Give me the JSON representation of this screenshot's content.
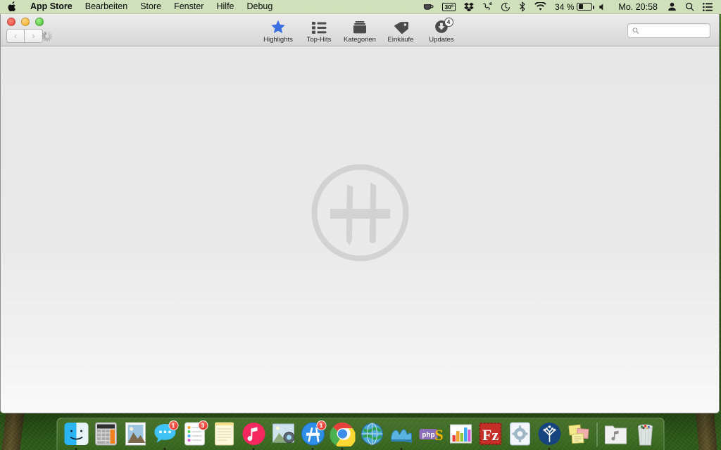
{
  "menubar": {
    "apple_icon": "apple-icon",
    "items": [
      {
        "label": "App Store",
        "bold": true
      },
      {
        "label": "Bearbeiten",
        "bold": false
      },
      {
        "label": "Store",
        "bold": false
      },
      {
        "label": "Fenster",
        "bold": false
      },
      {
        "label": "Hilfe",
        "bold": false
      },
      {
        "label": "Debug",
        "bold": false
      }
    ],
    "status": {
      "caffeine_icon": "coffee-cup-icon",
      "weather_temp": "30º",
      "dropbox_icon": "dropbox-icon",
      "phone_icon": "phone-handset-icon",
      "timemachine_icon": "time-machine-icon",
      "bluetooth_icon": "bluetooth-icon",
      "wifi_icon": "wifi-icon",
      "battery_percent": "34 %",
      "battery_level": 34,
      "volume_icon": "volume-icon",
      "clock": "Mo. 20:58",
      "user_icon": "user-account-icon",
      "spotlight_icon": "search-icon",
      "notification_icon": "notification-center-icon"
    }
  },
  "window": {
    "traffic_lights": {
      "close": "close-button",
      "minimize": "minimize-button",
      "zoom": "zoom-button",
      "colors": {
        "red": "#ef5b4e",
        "yellow": "#f9bc40",
        "green": "#5ece4b"
      }
    },
    "nav": {
      "back": "‹",
      "forward": "›"
    },
    "loading": "loading-spinner",
    "accent_color": "#3b6fe0",
    "tabs": [
      {
        "label": "Highlights",
        "icon": "star-icon",
        "active": true,
        "badge": null
      },
      {
        "label": "Top-Hits",
        "icon": "list-icon",
        "active": false,
        "badge": null
      },
      {
        "label": "Kategorien",
        "icon": "folder-icon",
        "active": false,
        "badge": null
      },
      {
        "label": "Einkäufe",
        "icon": "tag-icon",
        "active": false,
        "badge": null
      },
      {
        "label": "Updates",
        "icon": "download-icon",
        "active": false,
        "badge": "4"
      }
    ],
    "search": {
      "value": "",
      "placeholder": ""
    },
    "content": {
      "watermark": "app-store-logo-watermark"
    }
  },
  "dock": {
    "items": [
      {
        "name": "finder",
        "label": "Finder",
        "badge": null,
        "running": true
      },
      {
        "name": "calculator",
        "label": "Rechner",
        "badge": null,
        "running": false
      },
      {
        "name": "preview",
        "label": "Vorschau",
        "badge": null,
        "running": false
      },
      {
        "name": "messages",
        "label": "Nachrichten",
        "badge": "1",
        "running": true
      },
      {
        "name": "reminders",
        "label": "Erinnerungen",
        "badge": "3",
        "running": false
      },
      {
        "name": "notes",
        "label": "Notizen",
        "badge": null,
        "running": false
      },
      {
        "name": "itunes",
        "label": "iTunes",
        "badge": null,
        "running": true
      },
      {
        "name": "image-capture",
        "label": "Digitale Bilder",
        "badge": null,
        "running": false
      },
      {
        "name": "app-store",
        "label": "App Store",
        "badge": "1",
        "running": true
      },
      {
        "name": "chrome",
        "label": "Google Chrome",
        "badge": null,
        "running": true
      },
      {
        "name": "web-browser",
        "label": "Browser",
        "badge": null,
        "running": false
      },
      {
        "name": "mamp",
        "label": "MAMP",
        "badge": null,
        "running": true
      },
      {
        "name": "phpstorm",
        "label": "PhpStorm",
        "badge": null,
        "running": false
      },
      {
        "name": "charts",
        "label": "Numbers",
        "badge": null,
        "running": false
      },
      {
        "name": "filezilla",
        "label": "FileZilla",
        "badge": null,
        "running": false
      },
      {
        "name": "settings",
        "label": "Einstellungen",
        "badge": null,
        "running": false
      },
      {
        "name": "sourcetree",
        "label": "SourceTree",
        "badge": null,
        "running": true
      },
      {
        "name": "stickies",
        "label": "Notizzettel",
        "badge": null,
        "running": false
      },
      {
        "name": "music-folder",
        "label": "Musik",
        "badge": null,
        "running": false
      },
      {
        "name": "trash",
        "label": "Papierkorb",
        "badge": null,
        "running": false
      }
    ]
  }
}
